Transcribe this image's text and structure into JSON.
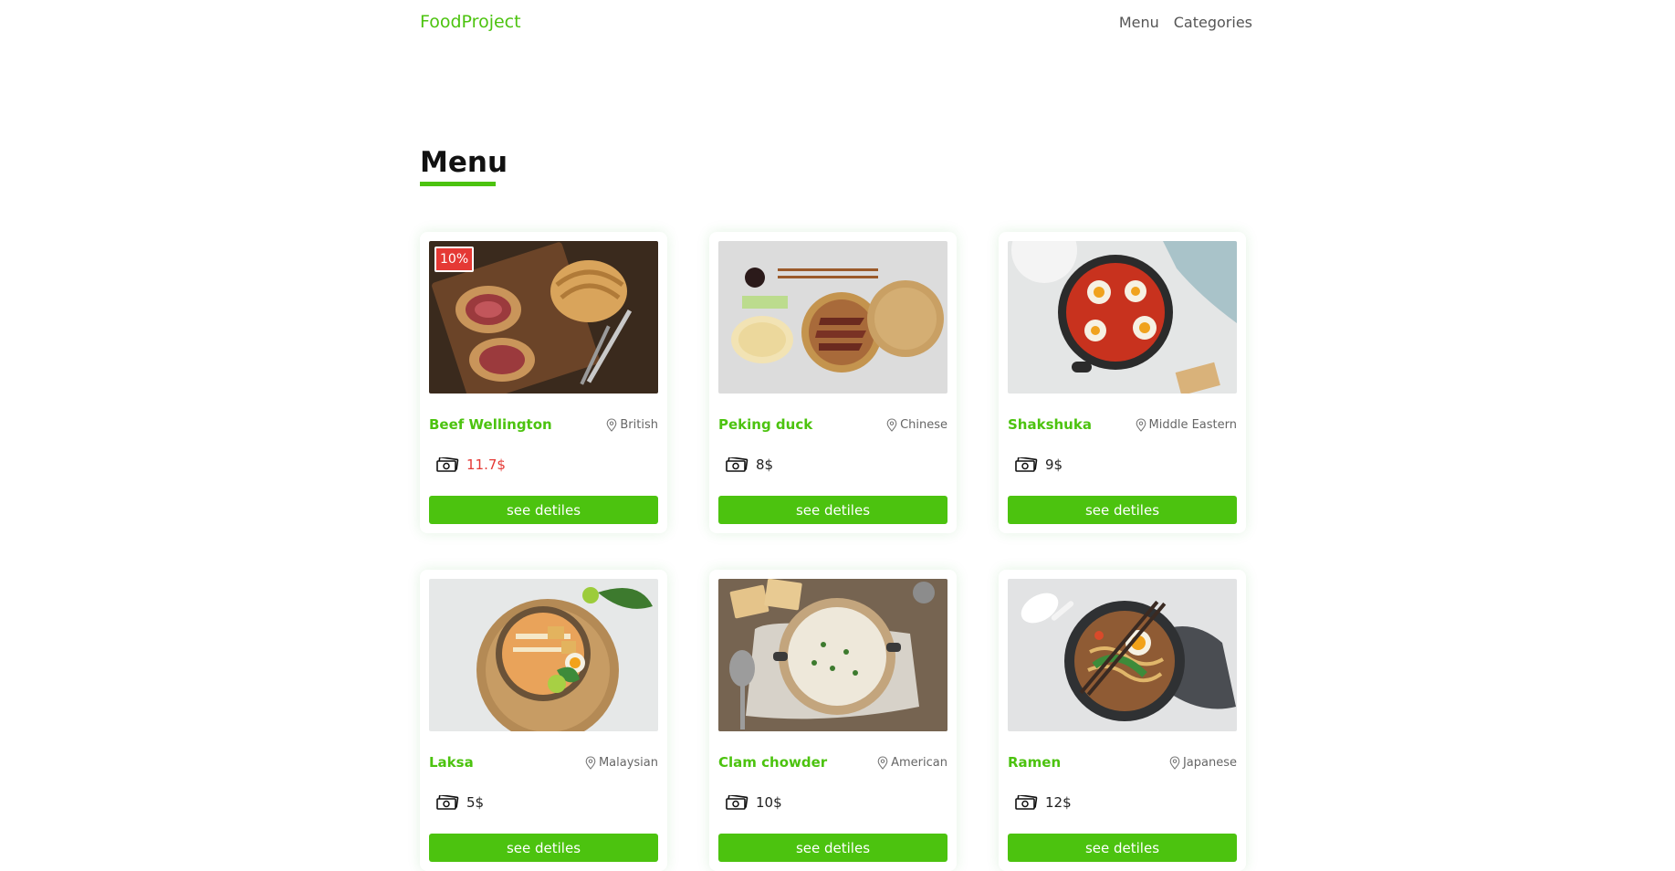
{
  "nav": {
    "brand": "FoodProject",
    "links": [
      "Menu",
      "Categories"
    ]
  },
  "menu": {
    "title": "Menu",
    "items": [
      {
        "name": "Beef Wellington",
        "origin": "British",
        "price": "11.7$",
        "discount": "10%",
        "button": "see detiles"
      },
      {
        "name": "Peking duck",
        "origin": "Chinese",
        "price": "8$",
        "button": "see detiles"
      },
      {
        "name": "Shakshuka",
        "origin": "Middle Eastern",
        "price": "9$",
        "button": "see detiles"
      },
      {
        "name": "Laksa",
        "origin": "Malaysian",
        "price": "5$",
        "button": "see detiles"
      },
      {
        "name": "Clam chowder",
        "origin": "American",
        "price": "10$",
        "button": "see detiles"
      },
      {
        "name": "Ramen",
        "origin": "Japanese",
        "price": "12$",
        "button": "see detiles"
      }
    ]
  },
  "colors": {
    "accent": "#4cc30f",
    "discount": "#e53935"
  },
  "icons": {
    "location": "map-pin-icon",
    "price": "money-bill-icon"
  }
}
